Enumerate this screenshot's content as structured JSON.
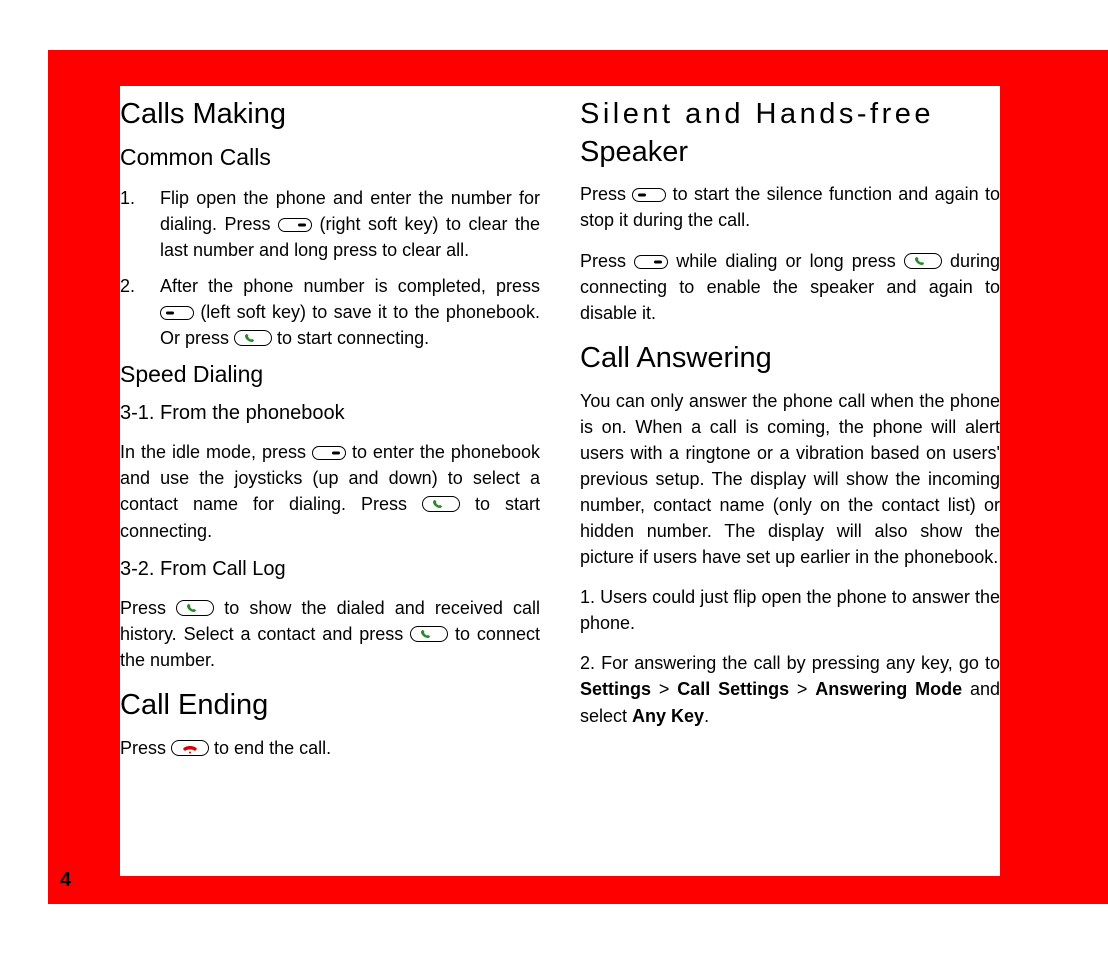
{
  "pageNumber": "4",
  "left": {
    "h1_callsMaking": "Calls Making",
    "h2_commonCalls": "Common Calls",
    "ol1": {
      "num": "1.",
      "a": "Flip open the phone and enter the number for dialing. Press ",
      "b": " (right soft key) to clear the last number and long press to clear all."
    },
    "ol2": {
      "num": "2.",
      "a": "After the phone number is completed, press ",
      "b": " (left soft key) to save it to the phonebook. Or press ",
      "c": " to start connecting."
    },
    "h2_speedDialing": "Speed Dialing",
    "h3_fromPhonebook": "3-1. From the phonebook",
    "p_fromPhonebook_a": "In the idle mode, press ",
    "p_fromPhonebook_b": " to enter the phonebook and use the joysticks (up and down) to select a contact name for dialing.  Press ",
    "p_fromPhonebook_c": "  to start connecting.",
    "h3_fromCallLog": "3-2.  From Call Log",
    "p_fromCallLog_a": "Press ",
    "p_fromCallLog_b": " to show the dialed and received call history. Select a contact and press ",
    "p_fromCallLog_c": " to connect the number.",
    "h1_callEnding": "Call Ending",
    "p_callEnding_a": " Press ",
    "p_callEnding_b": " to end the call."
  },
  "right": {
    "h1_silent_a": "Silent and Hands-free",
    "h1_silent_b": "Speaker",
    "p_silent1_a": "Press ",
    "p_silent1_b": " to start the silence function and again to stop it during the call.",
    "p_silent2_a": "Press ",
    "p_silent2_b": " while dialing or long press ",
    "p_silent2_c": "  during connecting to enable the speaker and again to disable it.",
    "h1_callAnswering": "Call Answering",
    "p_answer_intro": "You can only answer the phone call when the phone is on. When a call is coming, the phone will alert users with a ringtone or a vibration based on users' previous setup. The display will show the incoming number, contact name (only on the contact list) or hidden number. The display will also show the picture if users have set up earlier in the phonebook.",
    "p_answer_1": "1. Users could just flip open the phone to answer the phone.",
    "p_answer_2_a": "2. For answering the call by pressing any key, go to ",
    "p_answer_2_b": " > ",
    "p_answer_2_c": " > ",
    "p_answer_2_d": " and select ",
    "p_answer_2_e": ".",
    "bold_settings": "Settings",
    "bold_callSettings": "Call Settings",
    "bold_answeringMode": "Answering Mode",
    "bold_anyKey": "Any Key"
  }
}
